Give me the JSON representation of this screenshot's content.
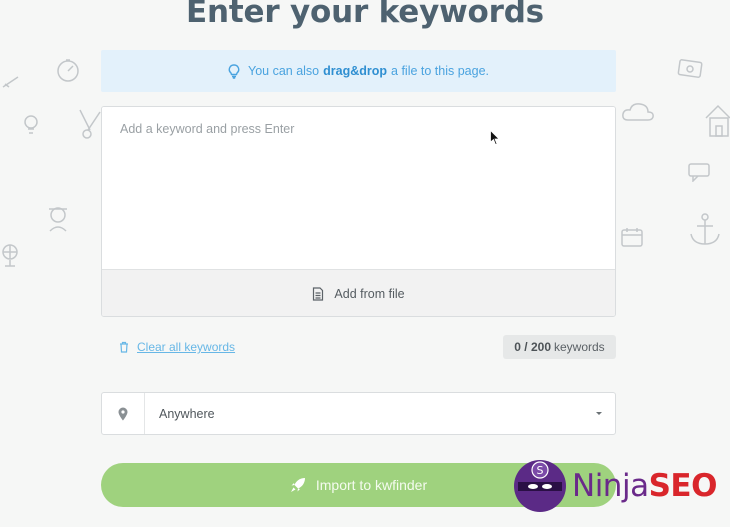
{
  "header": {
    "title": "Enter your keywords"
  },
  "hint": {
    "prefix": "You can also",
    "strong": "drag&drop",
    "suffix": "a file to this page."
  },
  "keywords": {
    "placeholder": "Add a keyword and press Enter",
    "value": "",
    "add_from_file_label": "Add from file"
  },
  "actions": {
    "clear_label": "Clear all keywords"
  },
  "counter": {
    "used": "0 / 200",
    "unit": "keywords"
  },
  "location": {
    "value": "Anywhere"
  },
  "import": {
    "label": "Import to kwfinder"
  },
  "watermark": {
    "part1": "Ninja",
    "part2": "SEO",
    "badge_letter": "S"
  },
  "colors": {
    "accent_blue": "#4aa3df",
    "hint_bg": "#e3f1fb",
    "import_green": "#9fd27e",
    "title": "#4e6270",
    "ninja_purple": "#6a2a8a",
    "ninja_red": "#d9262b"
  },
  "icons": {
    "hint": "lightbulb-icon",
    "file": "document-icon",
    "clear": "trash-icon",
    "location": "map-pin-icon",
    "dropdown": "caret-down-icon",
    "import": "rocket-icon"
  }
}
